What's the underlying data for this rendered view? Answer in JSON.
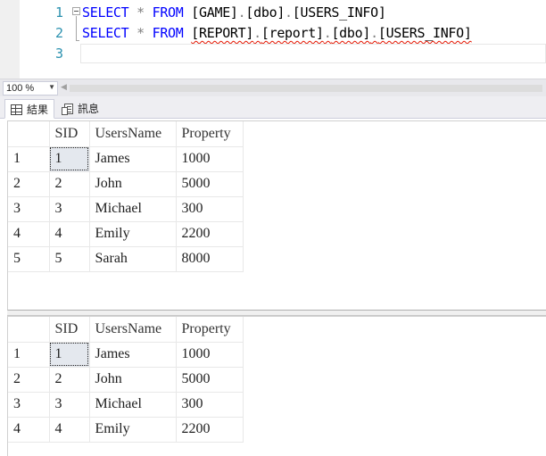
{
  "editor": {
    "line_numbers": [
      "1",
      "2",
      "3"
    ],
    "lines": [
      {
        "kw1": "SELECT",
        "star": "*",
        "kw2": "FROM",
        "parts": [
          "[GAME]",
          ".",
          "[dbo]",
          ".",
          "[USERS_INFO]"
        ]
      },
      {
        "kw1": "SELECT",
        "star": "*",
        "kw2": "FROM",
        "parts": [
          "[REPORT]",
          ".",
          "[report]",
          ".",
          "[dbo]",
          ".",
          "[USERS_INFO]"
        ]
      }
    ]
  },
  "zoom": {
    "value": "100 %"
  },
  "tabs": [
    {
      "label": "結果",
      "icon": "grid-icon"
    },
    {
      "label": "訊息",
      "icon": "messages-icon"
    }
  ],
  "results": [
    {
      "columns": [
        "SID",
        "UsersName",
        "Property"
      ],
      "rows": [
        {
          "rn": "1",
          "sid": "1",
          "name": "James",
          "prop": "1000"
        },
        {
          "rn": "2",
          "sid": "2",
          "name": "John",
          "prop": "5000"
        },
        {
          "rn": "3",
          "sid": "3",
          "name": "Michael",
          "prop": "300"
        },
        {
          "rn": "4",
          "sid": "4",
          "name": "Emily",
          "prop": "2200"
        },
        {
          "rn": "5",
          "sid": "5",
          "name": "Sarah",
          "prop": "8000"
        }
      ]
    },
    {
      "columns": [
        "SID",
        "UsersName",
        "Property"
      ],
      "rows": [
        {
          "rn": "1",
          "sid": "1",
          "name": "James",
          "prop": "1000"
        },
        {
          "rn": "2",
          "sid": "2",
          "name": "John",
          "prop": "5000"
        },
        {
          "rn": "3",
          "sid": "3",
          "name": "Michael",
          "prop": "300"
        },
        {
          "rn": "4",
          "sid": "4",
          "name": "Emily",
          "prop": "2200"
        }
      ]
    }
  ],
  "colors": {
    "keyword": "#0000ff",
    "operator": "#808080",
    "line_number": "#2b91af",
    "error_squiggle": "#e51400"
  }
}
